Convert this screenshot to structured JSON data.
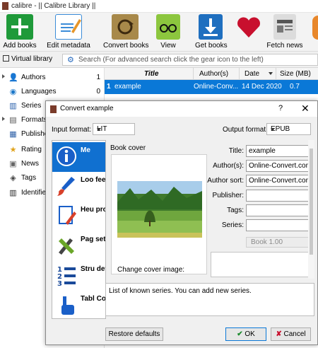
{
  "window": {
    "title": "calibre - || Calibre Library ||"
  },
  "toolbar": {
    "add_books": "Add books",
    "edit_metadata": "Edit metadata",
    "convert_books": "Convert books",
    "view": "View",
    "get_books": "Get books",
    "fetch_news": "Fetch news"
  },
  "search": {
    "virtual_library": "Virtual library",
    "placeholder": "Search (For advanced search click the gear icon to the left)"
  },
  "sidebar": {
    "items": [
      {
        "label": "Authors",
        "count": "1"
      },
      {
        "label": "Languages",
        "count": "0"
      },
      {
        "label": "Series",
        "count": ""
      },
      {
        "label": "Formats",
        "count": ""
      },
      {
        "label": "Publisher",
        "count": ""
      },
      {
        "label": "Rating",
        "count": ""
      },
      {
        "label": "News",
        "count": ""
      },
      {
        "label": "Tags",
        "count": ""
      },
      {
        "label": "Identifier",
        "count": ""
      }
    ]
  },
  "booklist": {
    "columns": [
      "Title",
      "Author(s)",
      "Date",
      "Size (MB)"
    ],
    "rows": [
      {
        "num": "1",
        "title": "example",
        "author": "Online-Conv...",
        "date": "14 Dec 2020",
        "size": "0.7"
      }
    ]
  },
  "dialog": {
    "title": "Convert example",
    "help": "?",
    "input_format_label": "Input format:",
    "input_format_value": "LIT",
    "output_format_label": "Output format:",
    "output_format_value": "EPUB",
    "sections": [
      "Me",
      "Loo feel",
      "Heu proc",
      "Pag setu",
      "Stru dete",
      "Tabl Con"
    ],
    "book_cover_label": "Book cover",
    "change_cover_label": "Change cover image:",
    "fields": {
      "title_label": "Title:",
      "title_value": "example",
      "authors_label": "Author(s):",
      "authors_value": "Online-Convert.com",
      "author_sort_label": "Author sort:",
      "author_sort_value": "Online-Convert.com",
      "publisher_label": "Publisher:",
      "publisher_value": "",
      "tags_label": "Tags:",
      "tags_value": "",
      "series_label": "Series:",
      "series_value": "",
      "series_index": "Book 1.00"
    },
    "help_text": "List of known series. You can add new series.",
    "restore_defaults": "Restore defaults",
    "ok": "OK",
    "cancel": "Cancel"
  },
  "colors": {
    "selection": "#0a78d7",
    "accent_green": "#23a23d",
    "accent_red": "#c8102e"
  }
}
